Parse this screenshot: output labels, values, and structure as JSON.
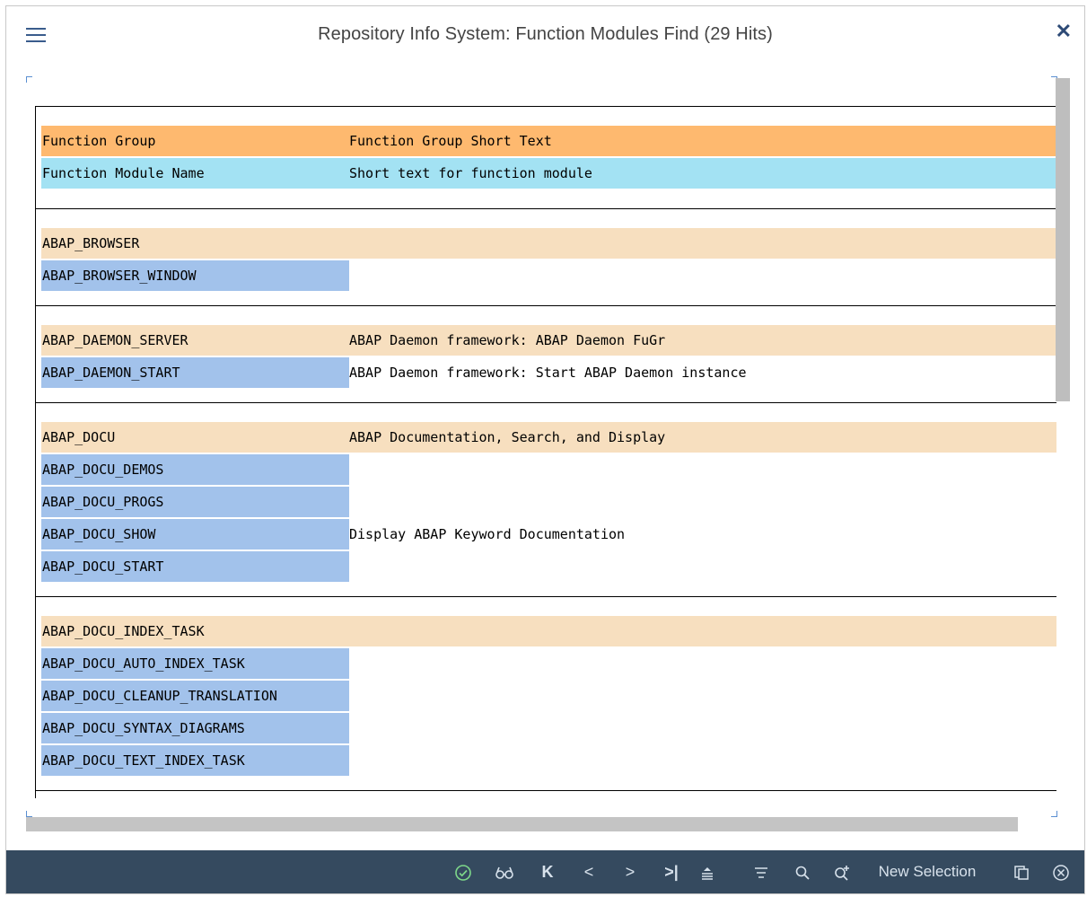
{
  "window": {
    "title": "Repository Info System: Function Modules Find (29 Hits)"
  },
  "columns": {
    "group_label": "Function Group",
    "group_text_label": "Function Group Short Text",
    "module_label": "Function Module Name",
    "module_text_label": "Short text for function module"
  },
  "groups": [
    {
      "name": "ABAP_BROWSER",
      "text": "",
      "modules": [
        {
          "name": "ABAP_BROWSER_WINDOW",
          "text": ""
        }
      ]
    },
    {
      "name": "ABAP_DAEMON_SERVER",
      "text": "ABAP Daemon framework: ABAP Daemon FuGr",
      "modules": [
        {
          "name": "ABAP_DAEMON_START",
          "text": "ABAP Daemon framework: Start ABAP Daemon instance"
        }
      ]
    },
    {
      "name": "ABAP_DOCU",
      "text": "ABAP Documentation, Search, and Display",
      "modules": [
        {
          "name": "ABAP_DOCU_DEMOS",
          "text": ""
        },
        {
          "name": "ABAP_DOCU_PROGS",
          "text": ""
        },
        {
          "name": "ABAP_DOCU_SHOW",
          "text": "Display ABAP Keyword Documentation"
        },
        {
          "name": "ABAP_DOCU_START",
          "text": ""
        }
      ]
    },
    {
      "name": "ABAP_DOCU_INDEX_TASK",
      "text": "",
      "modules": [
        {
          "name": "ABAP_DOCU_AUTO_INDEX_TASK",
          "text": ""
        },
        {
          "name": "ABAP_DOCU_CLEANUP_TRANSLATION",
          "text": ""
        },
        {
          "name": "ABAP_DOCU_SYNTAX_DIAGRAMS",
          "text": ""
        },
        {
          "name": "ABAP_DOCU_TEXT_INDEX_TASK",
          "text": ""
        }
      ]
    }
  ],
  "toolbar": {
    "new_selection_label": "New Selection",
    "icons": [
      "checkmark-icon",
      "glasses-icon",
      "first-page-icon",
      "previous-icon",
      "next-icon",
      "last-page-icon",
      "sort-ascending-icon",
      "filter-icon",
      "search-icon",
      "search-next-icon",
      "copy-icon",
      "cancel-icon"
    ]
  },
  "colors": {
    "header_group": "#feb96f",
    "header_module": "#a3e2f3",
    "group_row": "#f7dfbf",
    "module_row": "#a2c2eb",
    "footer": "#354a5f"
  }
}
